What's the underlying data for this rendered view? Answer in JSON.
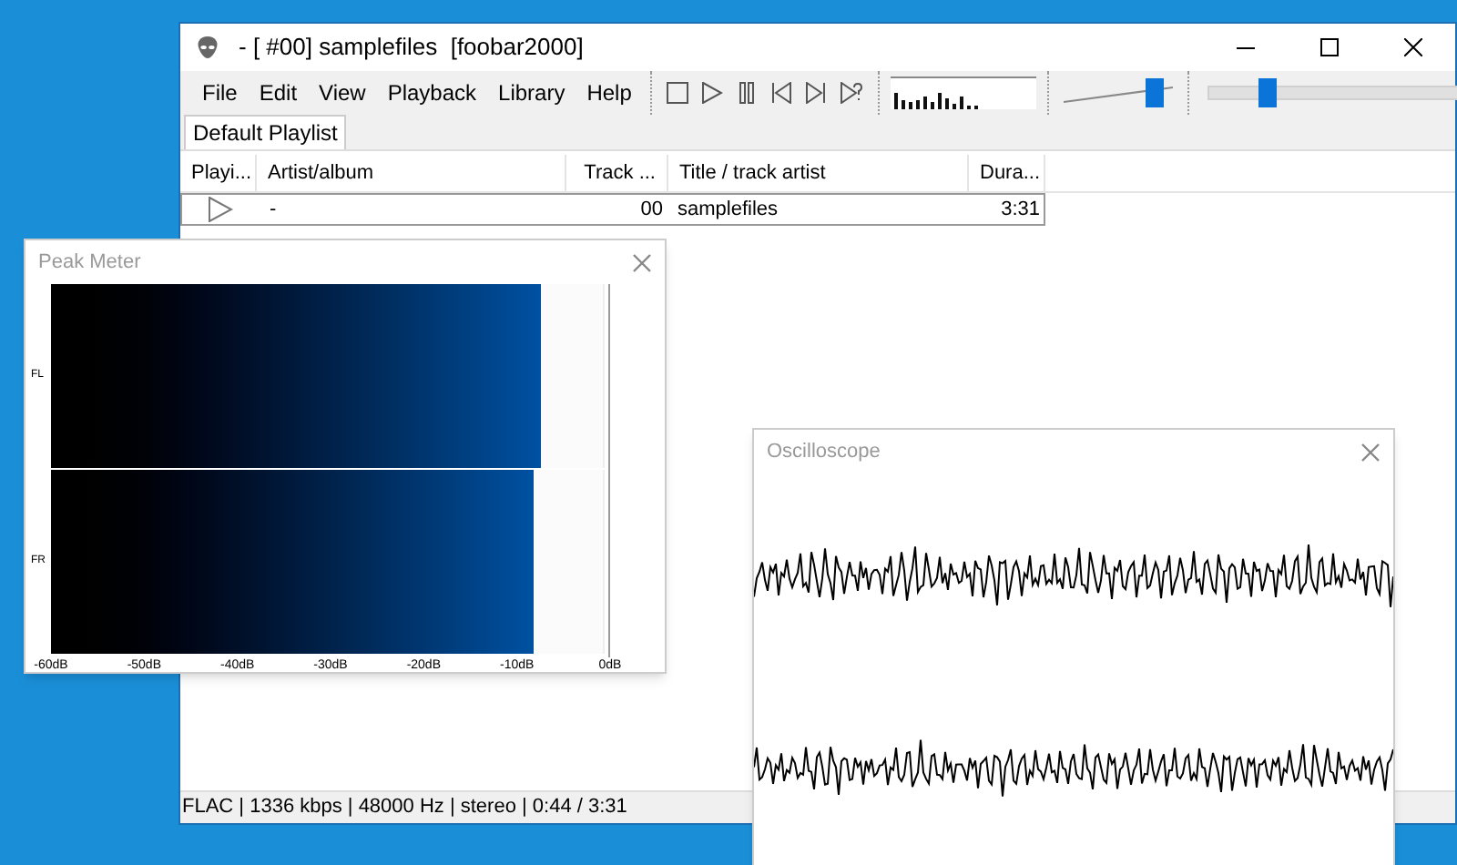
{
  "main_window": {
    "title": "- [ #00] samplefiles  [foobar2000]"
  },
  "menu": [
    "File",
    "Edit",
    "View",
    "Playback",
    "Library",
    "Help"
  ],
  "volume": {
    "level": 0.9
  },
  "seekbar": {
    "level": 0.21
  },
  "tabs": [
    {
      "label": "Default Playlist",
      "selected": true
    }
  ],
  "playlist": {
    "columns": [
      "Playi...",
      "Artist/album",
      "Track ...",
      "Title / track artist",
      "Dura..."
    ],
    "rows": [
      {
        "playing": true,
        "selected": true,
        "cells": [
          "",
          "-",
          "00",
          "samplefiles",
          "3:31"
        ]
      }
    ]
  },
  "status_bar": "FLAC | 1336 kbps | 48000 Hz | stereo | 0:44 / 3:31",
  "peak_meter": {
    "title": "Peak Meter",
    "channels": [
      {
        "name": "FL",
        "level": 0.886
      },
      {
        "name": "FR",
        "level": 0.873
      }
    ],
    "scale": [
      "-60dB",
      "-50dB",
      "-40dB",
      "-30dB",
      "-20dB",
      "-10dB",
      "0dB"
    ]
  },
  "oscilloscope": {
    "title": "Oscilloscope"
  }
}
